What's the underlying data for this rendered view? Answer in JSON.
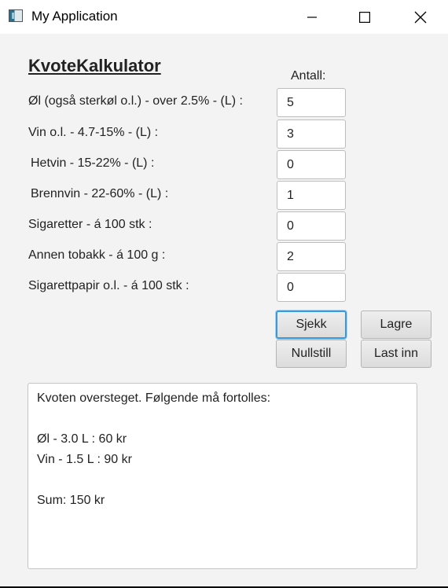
{
  "window": {
    "title": "My Application",
    "controls": [
      "minimize-icon",
      "maximize-icon",
      "close-icon"
    ]
  },
  "form": {
    "heading": "KvoteKalkulator",
    "antall_label": "Antall:",
    "rows": [
      {
        "label": "Øl (også sterkøl o.l.) - over 2.5% - (L) :",
        "value": "5"
      },
      {
        "label": "Vin o.l. - 4.7-15% - (L) :",
        "value": "3"
      },
      {
        "label": "Hetvin - 15-22% - (L) :",
        "value": "0"
      },
      {
        "label": "Brennvin - 22-60% - (L) :",
        "value": "1"
      },
      {
        "label": "Sigaretter - á 100 stk :",
        "value": "0"
      },
      {
        "label": "Annen tobakk - á 100 g :",
        "value": "2"
      },
      {
        "label": "Sigarettpapir o.l. - á 100 stk :",
        "value": "0"
      }
    ]
  },
  "buttons": {
    "check": "Sjekk",
    "save": "Lagre",
    "reset": "Nullstill",
    "load": "Last inn"
  },
  "output": {
    "lines": [
      "Kvoten oversteget. Følgende må fortolles:",
      "",
      "Øl - 3.0 L : 60 kr",
      "Vin - 1.5 L : 90 kr",
      "",
      "Sum: 150 kr"
    ]
  }
}
